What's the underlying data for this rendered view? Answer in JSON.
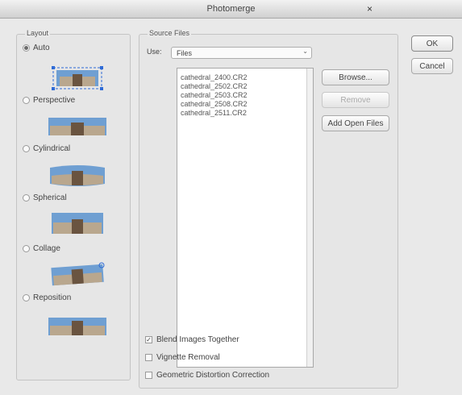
{
  "window": {
    "title": "Photomerge",
    "close_glyph": "×"
  },
  "layout": {
    "legend": "Layout",
    "options": [
      {
        "label": "Auto",
        "selected": true,
        "thumb": "auto-thumb"
      },
      {
        "label": "Perspective",
        "selected": false,
        "thumb": "perspective-thumb"
      },
      {
        "label": "Cylindrical",
        "selected": false,
        "thumb": "cylindrical-thumb"
      },
      {
        "label": "Spherical",
        "selected": false,
        "thumb": "spherical-thumb"
      },
      {
        "label": "Collage",
        "selected": false,
        "thumb": "collage-thumb"
      },
      {
        "label": "Reposition",
        "selected": false,
        "thumb": "reposition-thumb"
      }
    ]
  },
  "source": {
    "legend": "Source Files",
    "use_label": "Use:",
    "use_value": "Files",
    "files": [
      "cathedral_2400.CR2",
      "cathedral_2502.CR2",
      "cathedral_2503.CR2",
      "cathedral_2508.CR2",
      "cathedral_2511.CR2"
    ],
    "buttons": {
      "browse": "Browse...",
      "remove": "Remove",
      "add_open": "Add Open Files"
    }
  },
  "options": {
    "blend": {
      "label": "Blend Images Together",
      "checked": true
    },
    "vignette": {
      "label": "Vignette Removal",
      "checked": false
    },
    "distortion": {
      "label": "Geometric Distortion Correction",
      "checked": false
    }
  },
  "actions": {
    "ok": "OK",
    "cancel": "Cancel"
  },
  "colors": {
    "sky": "#6f9fd2",
    "building": "#b9a78e",
    "dark": "#6a5440",
    "selection": "#2f6bd6"
  }
}
